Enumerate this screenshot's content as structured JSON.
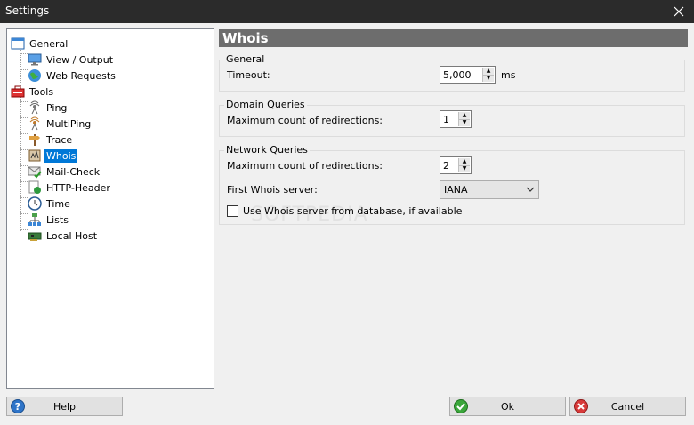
{
  "window": {
    "title": "Settings"
  },
  "tree": {
    "items": [
      {
        "label": "General",
        "icon": "window-icon"
      },
      {
        "label": "View / Output",
        "icon": "monitor-icon"
      },
      {
        "label": "Web Requests",
        "icon": "globe-icon"
      },
      {
        "label": "Tools",
        "icon": "toolbox-icon"
      },
      {
        "label": "Ping",
        "icon": "signal-icon"
      },
      {
        "label": "MultiPing",
        "icon": "multi-signal-icon"
      },
      {
        "label": "Trace",
        "icon": "signpost-icon"
      },
      {
        "label": "Whois",
        "icon": "book-icon",
        "selected": true
      },
      {
        "label": "Mail-Check",
        "icon": "envelope-check-icon"
      },
      {
        "label": "HTTP-Header",
        "icon": "document-globe-icon"
      },
      {
        "label": "Time",
        "icon": "clock-icon"
      },
      {
        "label": "Lists",
        "icon": "network-list-icon"
      },
      {
        "label": "Local Host",
        "icon": "network-card-icon"
      }
    ]
  },
  "panel": {
    "title": "Whois",
    "general": {
      "title": "General",
      "timeout_label": "Timeout:",
      "timeout_value": "5,000",
      "timeout_unit": "ms"
    },
    "domain": {
      "title": "Domain Queries",
      "max_label": "Maximum count of redirections:",
      "max_value": "1"
    },
    "network": {
      "title": "Network Queries",
      "max_label": "Maximum count of redirections:",
      "max_value": "2",
      "server_label": "First Whois server:",
      "server_value": "IANA",
      "use_db_label": "Use Whois server from database, if available",
      "use_db_checked": false
    }
  },
  "watermark": "SOFTPEDIA",
  "buttons": {
    "help": "Help",
    "ok": "Ok",
    "cancel": "Cancel"
  }
}
